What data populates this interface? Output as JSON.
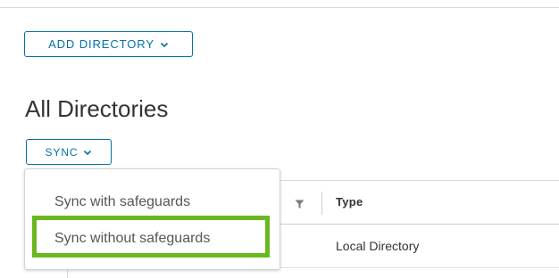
{
  "toolbar": {
    "add_directory_label": "ADD DIRECTORY"
  },
  "page": {
    "title": "All Directories"
  },
  "sync": {
    "button_label": "SYNC",
    "menu_items": [
      {
        "label": "Sync with safeguards"
      },
      {
        "label": "Sync without safeguards"
      }
    ],
    "highlighted_item": "Sync without safeguards"
  },
  "table": {
    "columns": [
      "Type"
    ],
    "rows": [
      {
        "type": "Local Directory"
      }
    ]
  },
  "colors": {
    "accent": "#0072a3",
    "highlight": "#6ab820",
    "text": "#333333"
  },
  "icons": {
    "dropdown_chevron": "chevron-down-icon",
    "column_filter": "filter-icon"
  }
}
